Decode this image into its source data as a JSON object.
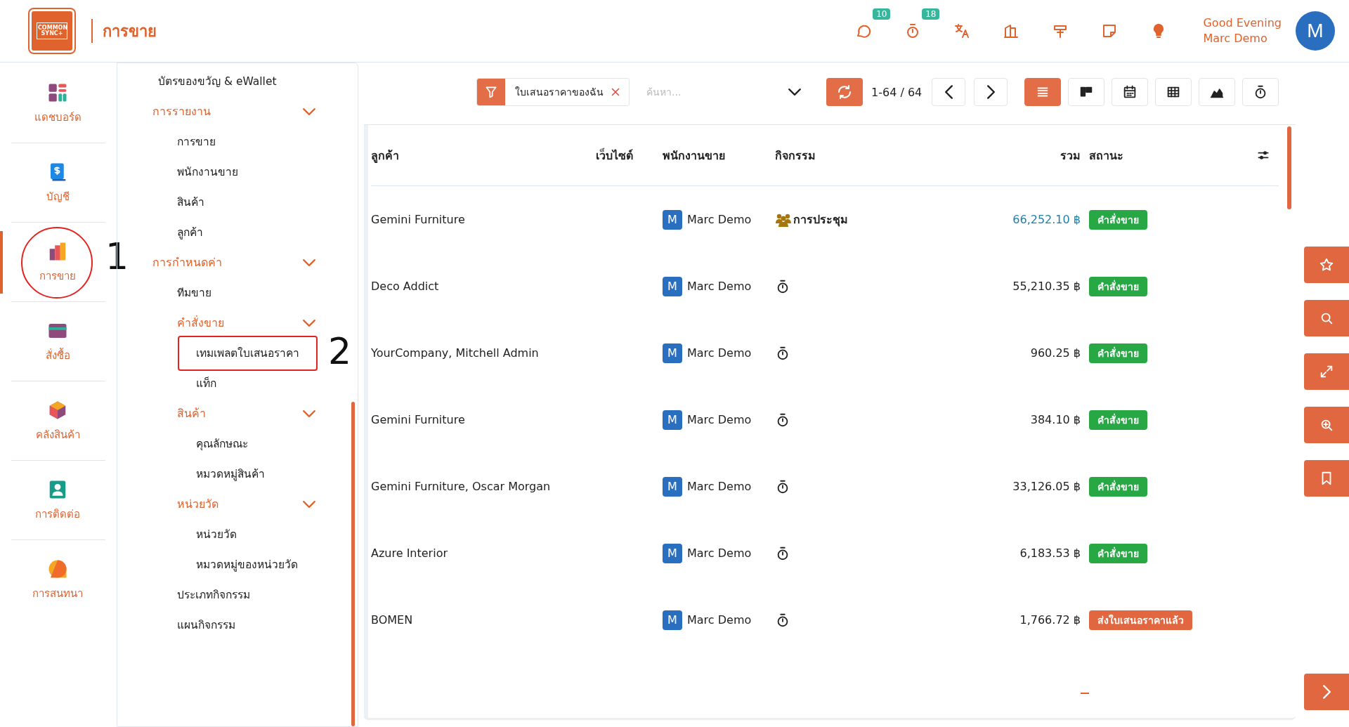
{
  "header": {
    "logo_text": "COMMON SYNC+",
    "app_title": "การขาย",
    "icons": [
      {
        "kind": "chat",
        "badge": "10"
      },
      {
        "kind": "timer",
        "badge": "18"
      },
      {
        "kind": "translate"
      },
      {
        "kind": "building"
      },
      {
        "kind": "sign"
      },
      {
        "kind": "note"
      },
      {
        "kind": "bulb"
      }
    ],
    "greeting": "Good Evening",
    "user": "Marc Demo",
    "avatar": "M"
  },
  "rail": {
    "items": [
      {
        "label": "แดชบอร์ด",
        "selected": false
      },
      {
        "label": "บัญชี",
        "selected": false
      },
      {
        "label": "การขาย",
        "selected": true,
        "annotation": "1"
      },
      {
        "label": "สั่งซื้อ",
        "selected": false
      },
      {
        "label": "คลังสินค้า",
        "selected": false
      },
      {
        "label": "การติดต่อ",
        "selected": false
      },
      {
        "label": "การสนทนา",
        "selected": false
      }
    ]
  },
  "menu": {
    "items": [
      {
        "kind": "link",
        "label": "บัตรของขวัญ & eWallet"
      },
      {
        "kind": "section",
        "label": "การรายงาน",
        "expanded": true,
        "children": [
          {
            "kind": "link",
            "label": "การขาย"
          },
          {
            "kind": "link",
            "label": "พนักงานขาย"
          },
          {
            "kind": "link",
            "label": "สินค้า"
          },
          {
            "kind": "link",
            "label": "ลูกค้า"
          }
        ]
      },
      {
        "kind": "section",
        "label": "การกำหนดค่า",
        "expanded": true,
        "children": [
          {
            "kind": "link",
            "label": "ทีมขาย"
          },
          {
            "kind": "section",
            "label": "คำสั่งขาย",
            "expanded": true,
            "children": [
              {
                "kind": "link",
                "label": "เทมเพลตใบเสนอราคา",
                "annotation": "2"
              },
              {
                "kind": "link",
                "label": "แท็ก"
              }
            ]
          },
          {
            "kind": "section",
            "label": "สินค้า",
            "expanded": true,
            "children": [
              {
                "kind": "link",
                "label": "คุณลักษณะ"
              },
              {
                "kind": "link",
                "label": "หมวดหมู่สินค้า"
              }
            ]
          },
          {
            "kind": "section",
            "label": "หน่วยวัด",
            "expanded": true,
            "children": [
              {
                "kind": "link",
                "label": "หน่วยวัด"
              },
              {
                "kind": "link",
                "label": "หมวดหมู่ของหน่วยวัด"
              }
            ]
          },
          {
            "kind": "link",
            "label": "ประเภทกิจกรรม"
          },
          {
            "kind": "link",
            "label": "แผนกิจกรรม"
          }
        ]
      }
    ]
  },
  "toolbar": {
    "filter": "ใบเสนอราคาของฉัน",
    "search": {
      "placeholder": "ค้นหา..."
    },
    "pager": "1-64 / 64",
    "views": [
      {
        "kind": "list",
        "selected": true
      },
      {
        "kind": "kanban",
        "selected": false
      },
      {
        "kind": "calendar",
        "selected": false
      },
      {
        "kind": "pivot",
        "selected": false
      },
      {
        "kind": "graph",
        "selected": false
      },
      {
        "kind": "activity",
        "selected": false
      }
    ]
  },
  "table": {
    "columns": [
      "ลูกค้า",
      "เว็บไซต์",
      "พนักงานขาย",
      "กิจกรรม",
      "รวม",
      "สถานะ"
    ],
    "rows": [
      {
        "customer": "Gemini Furniture",
        "avatar": "M",
        "salesperson": "Marc Demo",
        "activity": {
          "kind": "meeting",
          "label": "การประชุม"
        },
        "total": "66,252.10 ฿",
        "highlight": true,
        "status": {
          "label": "คำสั่งขาย",
          "color": "#28a745"
        }
      },
      {
        "customer": "Deco Addict",
        "avatar": "M",
        "salesperson": "Marc Demo",
        "activity": {
          "kind": "clock"
        },
        "total": "55,210.35 ฿",
        "highlight": false,
        "status": {
          "label": "คำสั่งขาย",
          "color": "#28a745"
        }
      },
      {
        "customer": "YourCompany, Mitchell Admin",
        "avatar": "M",
        "salesperson": "Marc Demo",
        "activity": {
          "kind": "clock"
        },
        "total": "960.25 ฿",
        "highlight": false,
        "status": {
          "label": "คำสั่งขาย",
          "color": "#28a745"
        }
      },
      {
        "customer": "Gemini Furniture",
        "avatar": "M",
        "salesperson": "Marc Demo",
        "activity": {
          "kind": "clock"
        },
        "total": "384.10 ฿",
        "highlight": false,
        "status": {
          "label": "คำสั่งขาย",
          "color": "#28a745"
        }
      },
      {
        "customer": "Gemini Furniture, Oscar Morgan",
        "avatar": "M",
        "salesperson": "Marc Demo",
        "activity": {
          "kind": "clock"
        },
        "total": "33,126.05 ฿",
        "highlight": false,
        "status": {
          "label": "คำสั่งขาย",
          "color": "#28a745"
        }
      },
      {
        "customer": "Azure Interior",
        "avatar": "M",
        "salesperson": "Marc Demo",
        "activity": {
          "kind": "clock"
        },
        "total": "6,183.53 ฿",
        "highlight": false,
        "status": {
          "label": "คำสั่งขาย",
          "color": "#28a745"
        }
      },
      {
        "customer": "BOMEN",
        "avatar": "M",
        "salesperson": "Marc Demo",
        "activity": {
          "kind": "clock"
        },
        "total": "1,766.72 ฿",
        "highlight": false,
        "status": {
          "label": "ส่งใบเสนอราคาแล้ว",
          "color": "#e0673f"
        }
      }
    ]
  }
}
